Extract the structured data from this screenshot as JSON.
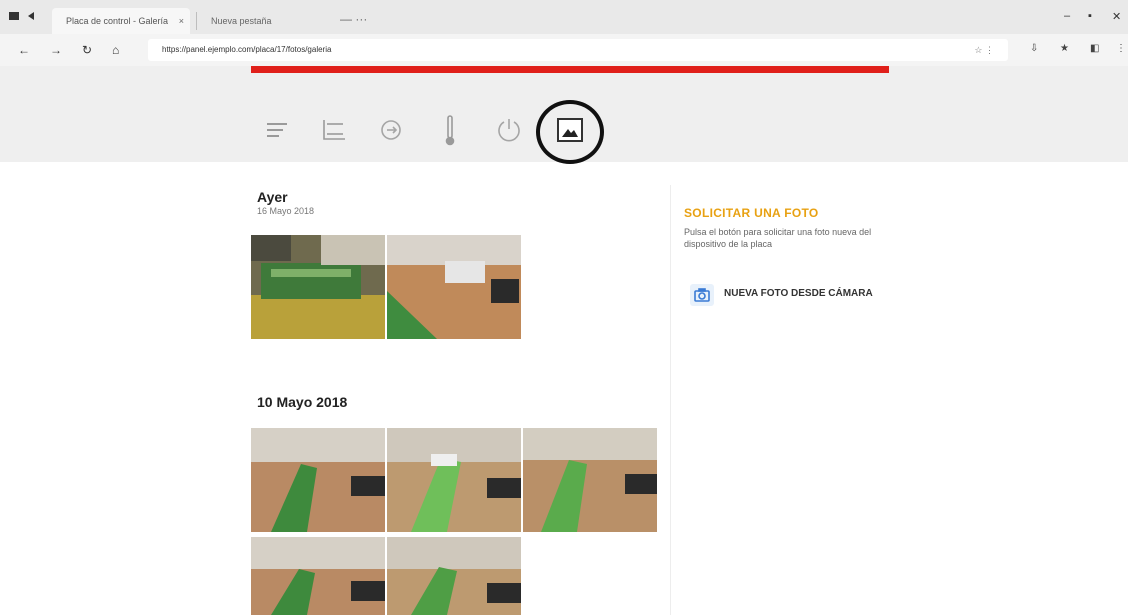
{
  "browser": {
    "tabs": [
      {
        "label": "Placa de control - Galería"
      },
      {
        "label": "Nueva pestaña"
      }
    ],
    "new_tab_glyph": "—  ···",
    "address": "https://panel.ejemplo.com/placa/17/fotos/galeria",
    "address_icons": "☆  ⋮",
    "nav": {
      "back": "←",
      "forward": "→",
      "reload": "↻",
      "home": "⌂"
    },
    "window": {
      "minimize": "–",
      "maximize": "▪",
      "close": "✕"
    },
    "tools": {
      "ext": "⇩",
      "star": "★",
      "menu": "⋮",
      "account": "◧"
    }
  },
  "toolbar": {
    "icons": [
      "list-icon",
      "chart-icon",
      "logout-icon",
      "thermometer-icon",
      "power-icon",
      "image-icon"
    ],
    "active": "image-icon"
  },
  "gallery": {
    "groups": [
      {
        "title": "Ayer",
        "subtitle": "16 Mayo 2018",
        "photos": 2
      },
      {
        "title": "10 Mayo 2018",
        "subtitle": "",
        "photos": 5
      }
    ]
  },
  "request": {
    "title": "SOLICITAR UNA FOTO",
    "description": "Pulsa el botón para solicitar una foto nueva del dispositivo de la placa",
    "button_label": "NUEVA FOTO DESDE CÁMARA"
  },
  "colors": {
    "progress_red": "#e0201b",
    "accent_orange": "#e8a112",
    "header_band": "#efefef"
  }
}
